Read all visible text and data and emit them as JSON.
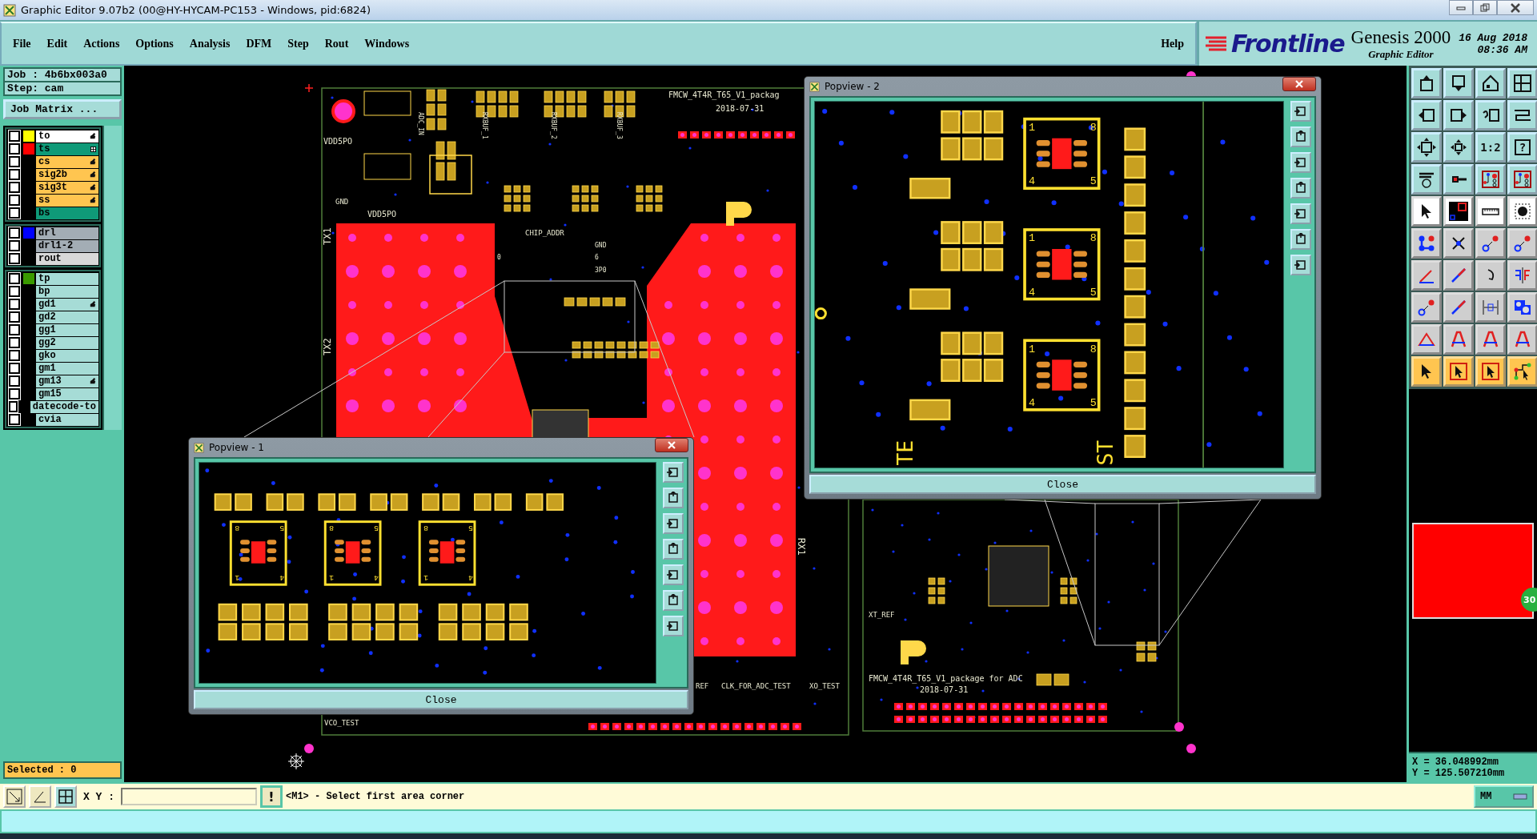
{
  "window": {
    "title": "Graphic Editor 9.07b2 (00@HY-HYCAM-PC153 - Windows, pid:6824)"
  },
  "menu": [
    {
      "label": "File"
    },
    {
      "label": "Edit"
    },
    {
      "label": "Actions"
    },
    {
      "label": "Options"
    },
    {
      "label": "Analysis"
    },
    {
      "label": "DFM"
    },
    {
      "label": "Step"
    },
    {
      "label": "Rout"
    },
    {
      "label": "Windows"
    }
  ],
  "help": "Help",
  "brand": {
    "logo": "Frontline",
    "product": "Genesis 2000",
    "subtitle": "Graphic Editor",
    "date": "16 Aug 2018",
    "time": "08:36 AM"
  },
  "job": {
    "job": "Job : 4b6bx003a0",
    "step": "Step: cam",
    "matrix_button": "Job Matrix ..."
  },
  "layer_groups": [
    [
      {
        "name": "to",
        "selected": true,
        "checked": false,
        "color": "#ffff00",
        "affected": true,
        "attributes": false
      },
      {
        "name": "ts",
        "kind": "mask",
        "selected": false,
        "checked": false,
        "color": "#ff0000",
        "affected": false,
        "attributes": true
      },
      {
        "name": "cs",
        "kind": "signal",
        "selected": false,
        "checked": false,
        "affected": true,
        "attributes": false
      },
      {
        "name": "sig2b",
        "kind": "signal",
        "selected": false,
        "checked": false,
        "affected": true,
        "attributes": false
      },
      {
        "name": "sig3t",
        "kind": "signal",
        "selected": false,
        "checked": false,
        "affected": true,
        "attributes": false
      },
      {
        "name": "ss",
        "kind": "signal",
        "selected": false,
        "checked": false,
        "affected": true,
        "attributes": false
      },
      {
        "name": "bs",
        "kind": "mask",
        "selected": false,
        "checked": false,
        "affected": false,
        "attributes": false
      }
    ],
    [
      {
        "name": "drl",
        "kind": "drill",
        "selected": false,
        "checked": false,
        "color": "#0000ff",
        "affected": false,
        "attributes": false
      },
      {
        "name": "drl1-2",
        "kind": "drill",
        "selected": false,
        "checked": false,
        "affected": false,
        "attributes": false
      },
      {
        "name": "rout",
        "kind": "rout",
        "selected": false,
        "checked": false,
        "affected": false,
        "attributes": false
      }
    ],
    [
      {
        "name": "tp",
        "kind": "document",
        "selected": false,
        "checked": false,
        "color": "#3a9a00",
        "affected": false,
        "attributes": false
      },
      {
        "name": "bp",
        "kind": "document",
        "selected": false,
        "checked": false,
        "affected": false,
        "attributes": false
      },
      {
        "name": "gd1",
        "kind": "document",
        "selected": false,
        "checked": false,
        "affected": true,
        "attributes": false
      },
      {
        "name": "gd2",
        "kind": "document",
        "selected": false,
        "checked": false,
        "affected": false,
        "attributes": false
      },
      {
        "name": "gg1",
        "kind": "document",
        "selected": false,
        "checked": false,
        "affected": false,
        "attributes": false
      },
      {
        "name": "gg2",
        "kind": "document",
        "selected": false,
        "checked": false,
        "affected": false,
        "attributes": false
      },
      {
        "name": "gko",
        "kind": "document",
        "selected": false,
        "checked": false,
        "affected": false,
        "attributes": false
      },
      {
        "name": "gm1",
        "kind": "document",
        "selected": false,
        "checked": false,
        "affected": false,
        "attributes": false
      },
      {
        "name": "gm13",
        "kind": "document",
        "selected": false,
        "checked": false,
        "affected": true,
        "attributes": false
      },
      {
        "name": "gm15",
        "kind": "document",
        "selected": false,
        "checked": false,
        "affected": false,
        "attributes": false
      },
      {
        "name": "datecode-to",
        "kind": "document",
        "selected": false,
        "checked": false,
        "affected": false,
        "attributes": false
      },
      {
        "name": "cvia",
        "kind": "document",
        "selected": false,
        "checked": false,
        "affected": false,
        "attributes": false
      }
    ]
  ],
  "selected_count": "Selected : 0",
  "pcb_labels": [
    "FMCW_4T4R_T65_V1_packag",
    "2018-07-31",
    "VDD5PO",
    "GND",
    "VDD5PO",
    "CHIP_ADDR",
    "GND",
    "6",
    "3P0",
    "0",
    "TX1",
    "TX2",
    "RX1",
    "ADC_IN",
    "RXBUF_1",
    "RXBUF_2",
    "RXBUF_3",
    "VCO_TEST",
    "REF",
    "CLK_FOR_ADC_TEST",
    "XO_TEST",
    "XT_REF",
    "FMCW_4T4R_T65_V1_package for ADC",
    "2018-07-31"
  ],
  "popviews": [
    {
      "title": "Popview - 1",
      "close": "Close",
      "chips": [
        {
          "pins": [
            "8",
            "5",
            "1",
            "4"
          ]
        },
        {
          "pins": [
            "8",
            "5",
            "1",
            "4"
          ]
        },
        {
          "pins": [
            "8",
            "5",
            "1",
            "4"
          ]
        }
      ]
    },
    {
      "title": "Popview - 2",
      "close": "Close",
      "chips": [
        {
          "pins": [
            "1",
            "8",
            "4",
            "5"
          ]
        },
        {
          "pins": [
            "1",
            "8",
            "4",
            "5"
          ]
        },
        {
          "pins": [
            "1",
            "8",
            "4",
            "5"
          ]
        }
      ],
      "labels": [
        "TE",
        "ST"
      ]
    }
  ],
  "toolbar": {
    "zoom_ratio": "1:2",
    "help": "?"
  },
  "badge": "30",
  "coordinates": {
    "x": "X = 36.048992mm",
    "y": "Y = 125.507210mm"
  },
  "command": {
    "xy_label": "X Y :",
    "alert": "!",
    "prompt": "<M1> - Select first area corner",
    "units": "MM"
  }
}
